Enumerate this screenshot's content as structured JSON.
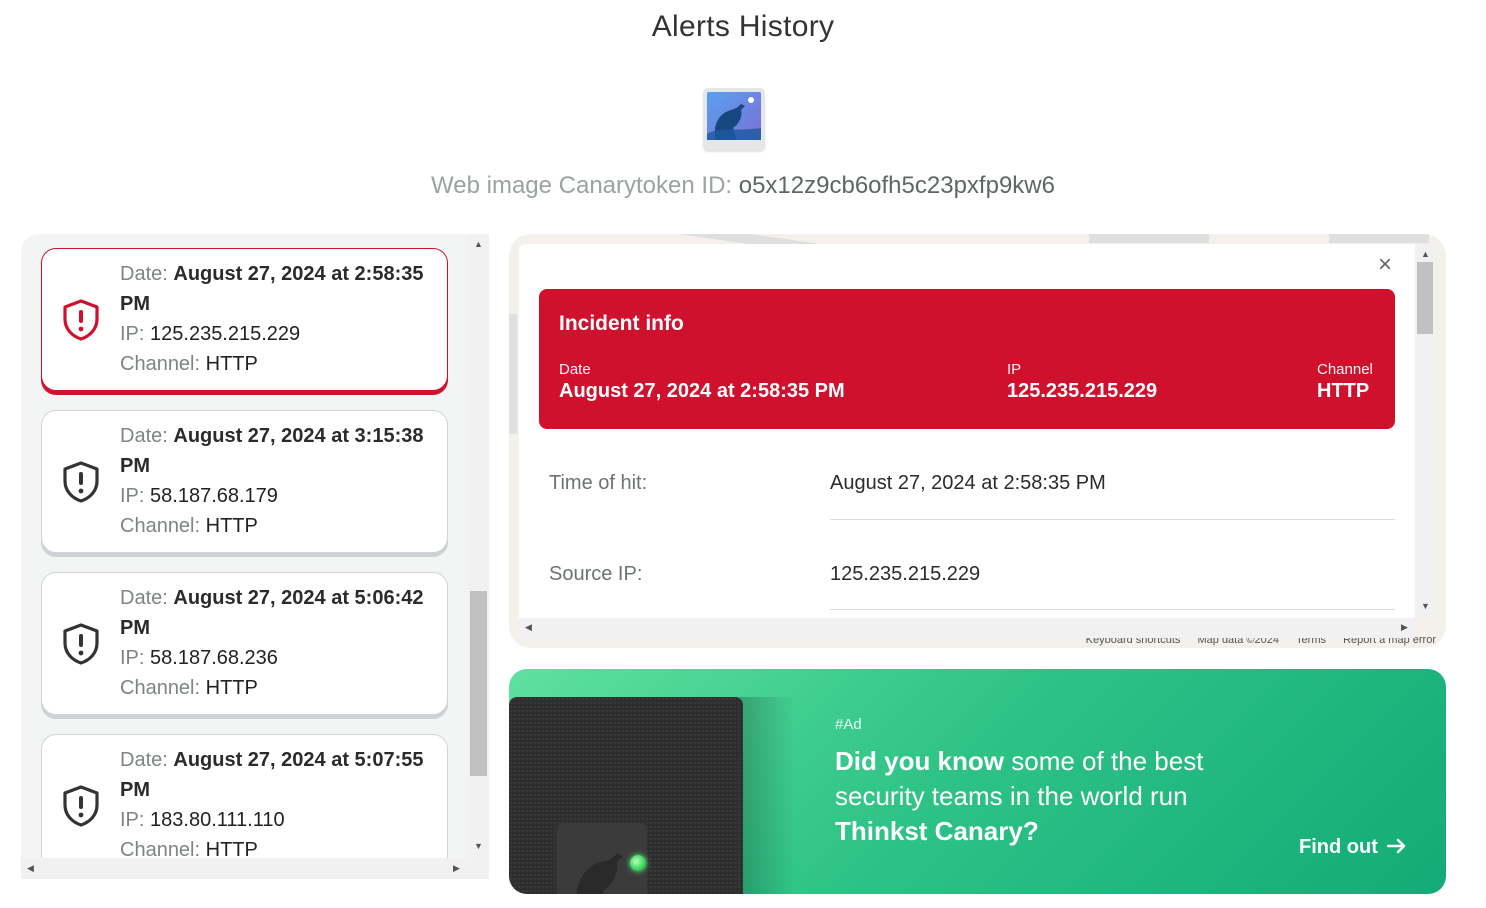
{
  "page": {
    "title": "Alerts History",
    "token_label": "Web image Canarytoken ID:",
    "token_id": "o5x12z9cb6ofh5c23pxfp9kw6",
    "token_icon": "image-icon"
  },
  "alerts": {
    "labels": {
      "date": "Date:",
      "ip": "IP:",
      "channel": "Channel:"
    },
    "items": [
      {
        "date": "August 27, 2024 at 2:58:35 PM",
        "ip": "125.235.215.229",
        "channel": "HTTP",
        "selected": true
      },
      {
        "date": "August 27, 2024 at 3:15:38 PM",
        "ip": "58.187.68.179",
        "channel": "HTTP",
        "selected": false
      },
      {
        "date": "August 27, 2024 at 5:06:42 PM",
        "ip": "58.187.68.236",
        "channel": "HTTP",
        "selected": false
      },
      {
        "date": "August 27, 2024 at 5:07:55 PM",
        "ip": "183.80.111.110",
        "channel": "HTTP",
        "selected": false
      }
    ]
  },
  "incident": {
    "title": "Incident info",
    "date_label": "Date",
    "date": "August 27, 2024 at 2:58:35 PM",
    "ip_label": "IP",
    "ip": "125.235.215.229",
    "channel_label": "Channel",
    "channel": "HTTP",
    "details": [
      {
        "label": "Time of hit:",
        "value": "August 27, 2024 at 2:58:35 PM"
      },
      {
        "label": "Source IP:",
        "value": "125.235.215.229"
      }
    ],
    "close_icon": "close-icon"
  },
  "map": {
    "footer": [
      "Keyboard shortcuts",
      "Map data ©2024",
      "Terms",
      "Report a map error"
    ]
  },
  "ad": {
    "tag": "#Ad",
    "headline_bold": "Did you know",
    "headline_rest": "some of the best security teams in the world run",
    "headline_product": "Thinkst Canary?",
    "cta": "Find out",
    "cta_icon": "arrow-right-icon"
  },
  "colors": {
    "alert_red": "#d0112e",
    "ad_green": "#2fc486"
  }
}
